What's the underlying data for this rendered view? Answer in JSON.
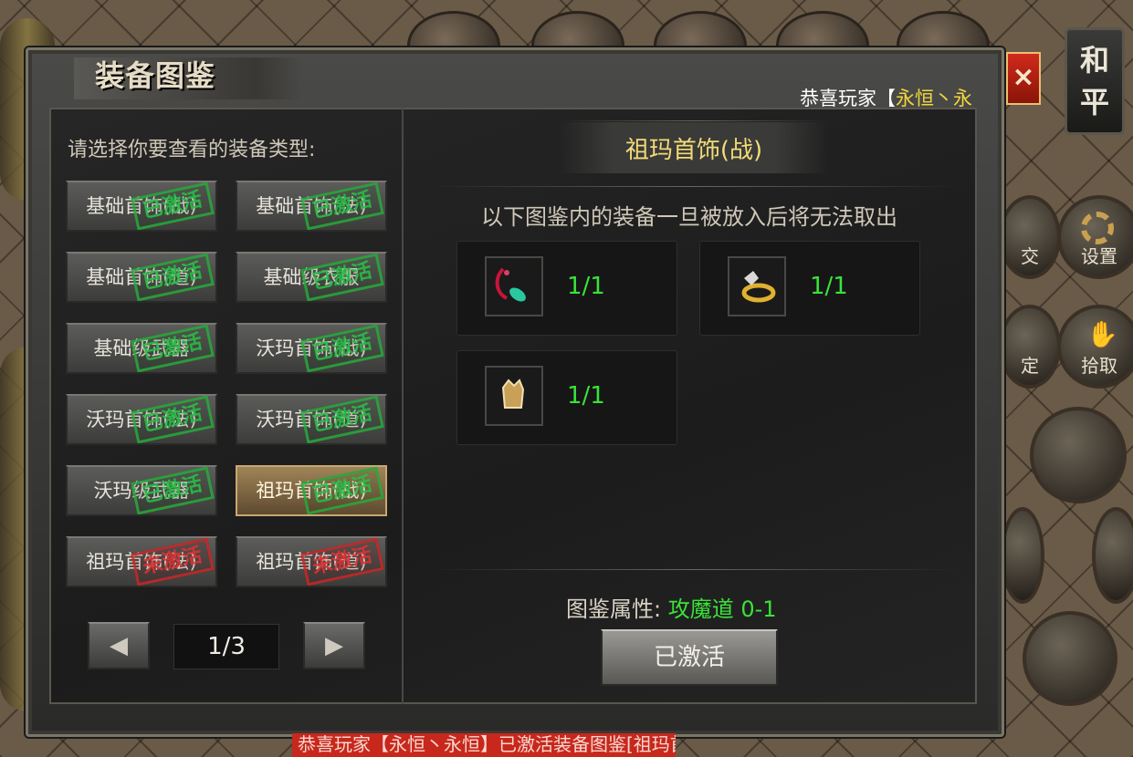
{
  "window": {
    "title": "装备图鉴",
    "close_label": "×",
    "notice_prefix": "恭喜玩家【",
    "notice_name": "永恒丶永",
    "bottom_message": "恭喜玩家【永恒丶永恒】已激活装备图鉴[祖玛首饰(战)]，获得属性加成！"
  },
  "side": {
    "peace_mode": "和平",
    "settings_label": "设置",
    "pickup_label": "拾取",
    "partial_label_1": "交",
    "partial_label_2": "定"
  },
  "left_panel": {
    "prompt": "请选择你要查看的装备类型:",
    "categories": [
      {
        "label": "基础首饰(战)",
        "stamp": "已激活",
        "status": "activated"
      },
      {
        "label": "基础首饰(法)",
        "stamp": "已激活",
        "status": "activated"
      },
      {
        "label": "基础首饰(道)",
        "stamp": "已激活",
        "status": "activated"
      },
      {
        "label": "基础级衣服",
        "stamp": "已激活",
        "status": "activated"
      },
      {
        "label": "基础级武器",
        "stamp": "已激活",
        "status": "activated"
      },
      {
        "label": "沃玛首饰(战)",
        "stamp": "已激活",
        "status": "activated"
      },
      {
        "label": "沃玛首饰(法)",
        "stamp": "已激活",
        "status": "activated"
      },
      {
        "label": "沃玛首饰(道)",
        "stamp": "已激活",
        "status": "activated"
      },
      {
        "label": "沃玛级武器",
        "stamp": "已激活",
        "status": "activated"
      },
      {
        "label": "祖玛首饰(战)",
        "stamp": "已激活",
        "status": "activated",
        "selected": true
      },
      {
        "label": "祖玛首饰(法)",
        "stamp": "未激活",
        "status": "inactive"
      },
      {
        "label": "祖玛首饰(道)",
        "stamp": "未激活",
        "status": "inactive"
      }
    ],
    "prev_icon": "◀",
    "next_icon": "▶",
    "page": "1/3"
  },
  "right_panel": {
    "title": "祖玛首饰(战)",
    "warning": "以下图鉴内的装备一旦被放入后将无法取出",
    "items": [
      {
        "icon": "necklace-icon",
        "count": "1/1"
      },
      {
        "icon": "ring-icon",
        "count": "1/1"
      },
      {
        "icon": "bracelet-icon",
        "count": "1/1"
      }
    ],
    "attr_label": "图鉴属性:",
    "attr_value": "攻魔道 0-1",
    "activated_label": "已激活"
  },
  "colors": {
    "accent_green": "#3ae23a",
    "title_gold": "#f2dc78",
    "stamp_green": "#28be46",
    "stamp_red": "#dc3232"
  }
}
